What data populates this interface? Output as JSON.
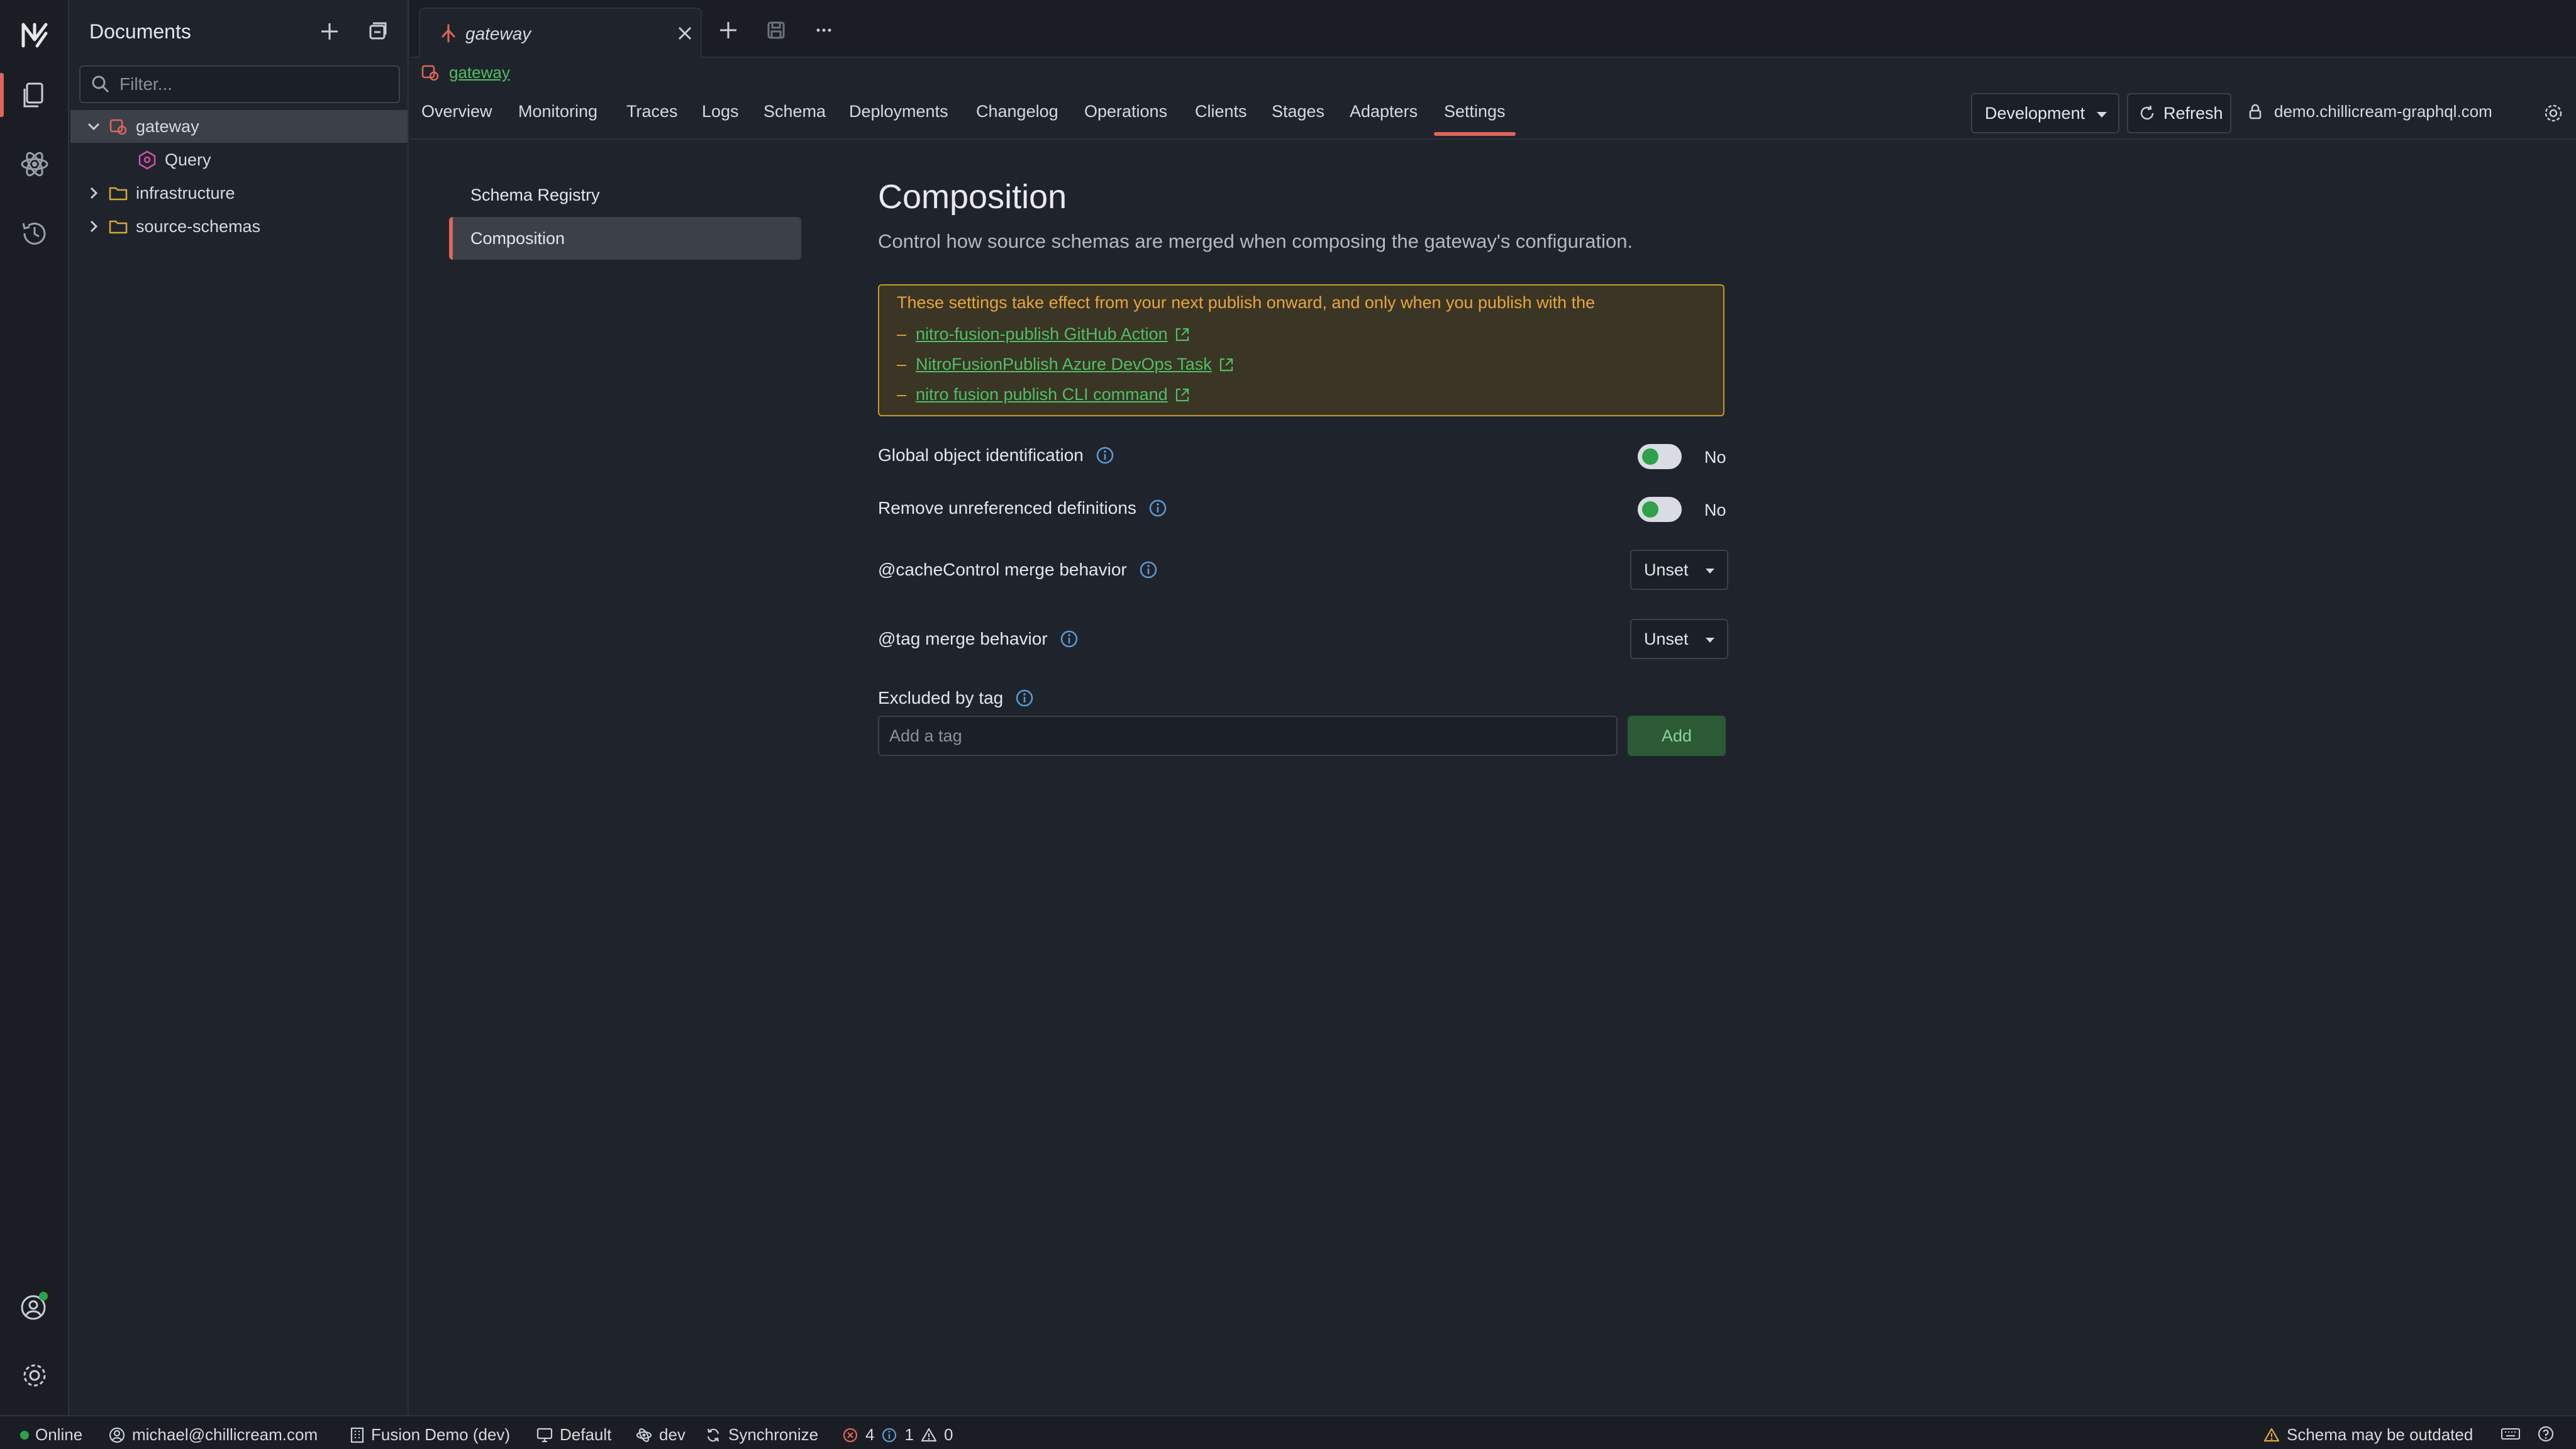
{
  "colors": {
    "accent": "#e0655a",
    "link": "#4fbf66",
    "warning": "#e8a53b",
    "online": "#2fa14a"
  },
  "sidebar": {
    "title": "Documents",
    "filter_placeholder": "Filter...",
    "tree": [
      {
        "label": "gateway",
        "icon": "gateway-icon",
        "expanded": true,
        "selected": true
      },
      {
        "label": "Query",
        "icon": "graphql-icon"
      },
      {
        "label": "infrastructure",
        "icon": "folder-icon",
        "expanded": false
      },
      {
        "label": "source-schemas",
        "icon": "folder-icon",
        "expanded": false
      }
    ]
  },
  "tab": {
    "label": "gateway"
  },
  "breadcrumb": {
    "label": "gateway"
  },
  "nav": {
    "items": [
      "Overview",
      "Monitoring",
      "Traces",
      "Logs",
      "Schema",
      "Deployments",
      "Changelog",
      "Operations",
      "Clients",
      "Stages",
      "Adapters",
      "Settings"
    ],
    "active": "Settings",
    "environment": "Development",
    "refresh_label": "Refresh",
    "domain": "demo.chillicream-graphql.com"
  },
  "settings_menu": {
    "items": [
      "Schema Registry",
      "Composition"
    ],
    "active": "Composition"
  },
  "content": {
    "title": "Composition",
    "description": "Control how source schemas are merged when composing the gateway's configuration.",
    "notice": {
      "text": "These settings take effect from your next publish onward, and only when you publish with the",
      "links": [
        "nitro-fusion-publish GitHub Action",
        "NitroFusionPublish Azure DevOps Task",
        "nitro fusion publish CLI command"
      ],
      "dash": "–"
    },
    "global_object_id": {
      "label": "Global object identification",
      "value": "No"
    },
    "remove_unreferenced": {
      "label": "Remove unreferenced definitions",
      "value": "No"
    },
    "cache_control": {
      "label": "@cacheControl merge behavior",
      "value": "Unset"
    },
    "tag_merge": {
      "label": "@tag merge behavior",
      "value": "Unset"
    },
    "excluded_by_tag": {
      "label": "Excluded by tag",
      "placeholder": "Add a tag",
      "add_label": "Add"
    }
  },
  "statusbar": {
    "online": "Online",
    "user": "michael@chillicream.com",
    "workspace": "Fusion Demo (dev)",
    "profile": "Default",
    "stage": "dev",
    "sync": "Synchronize",
    "errors": "4",
    "infos": "1",
    "warnings": "0",
    "schema_warning": "Schema may be outdated"
  }
}
